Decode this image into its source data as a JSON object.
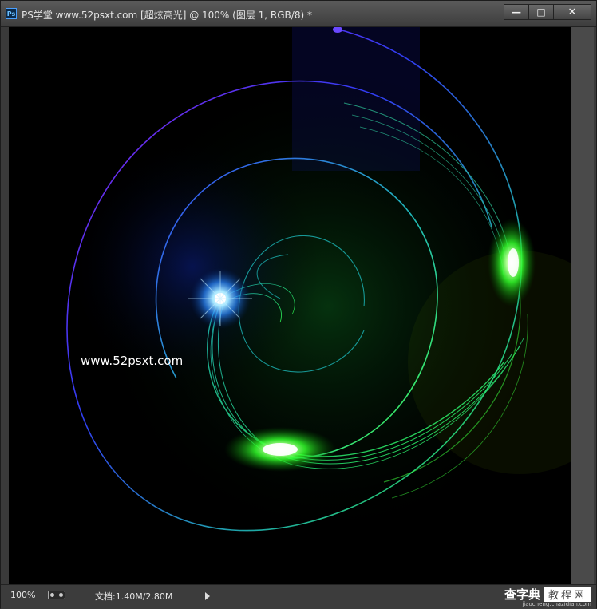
{
  "window": {
    "title": "PS学堂 www.52psxt.com [超炫高光] @ 100% (图层 1, RGB/8) *",
    "app_icon": "Ps",
    "buttons": {
      "minimize": "—",
      "maximize": "□",
      "close": "✕"
    }
  },
  "canvas": {
    "watermark_text": "www.52psxt.com"
  },
  "statusbar": {
    "zoom": "100%",
    "doc_info": "文档:1.40M/2.80M"
  },
  "site_watermark": {
    "main": "查字典",
    "tag": "教程网",
    "sub": "jiaocheng.chazidian.com"
  },
  "colors": {
    "arc_blue": "#3340ff",
    "arc_purple": "#8a2be2",
    "arc_teal": "#19c8c8",
    "glow_green": "#3cff3c",
    "glow_blue": "#6fd2ff"
  }
}
